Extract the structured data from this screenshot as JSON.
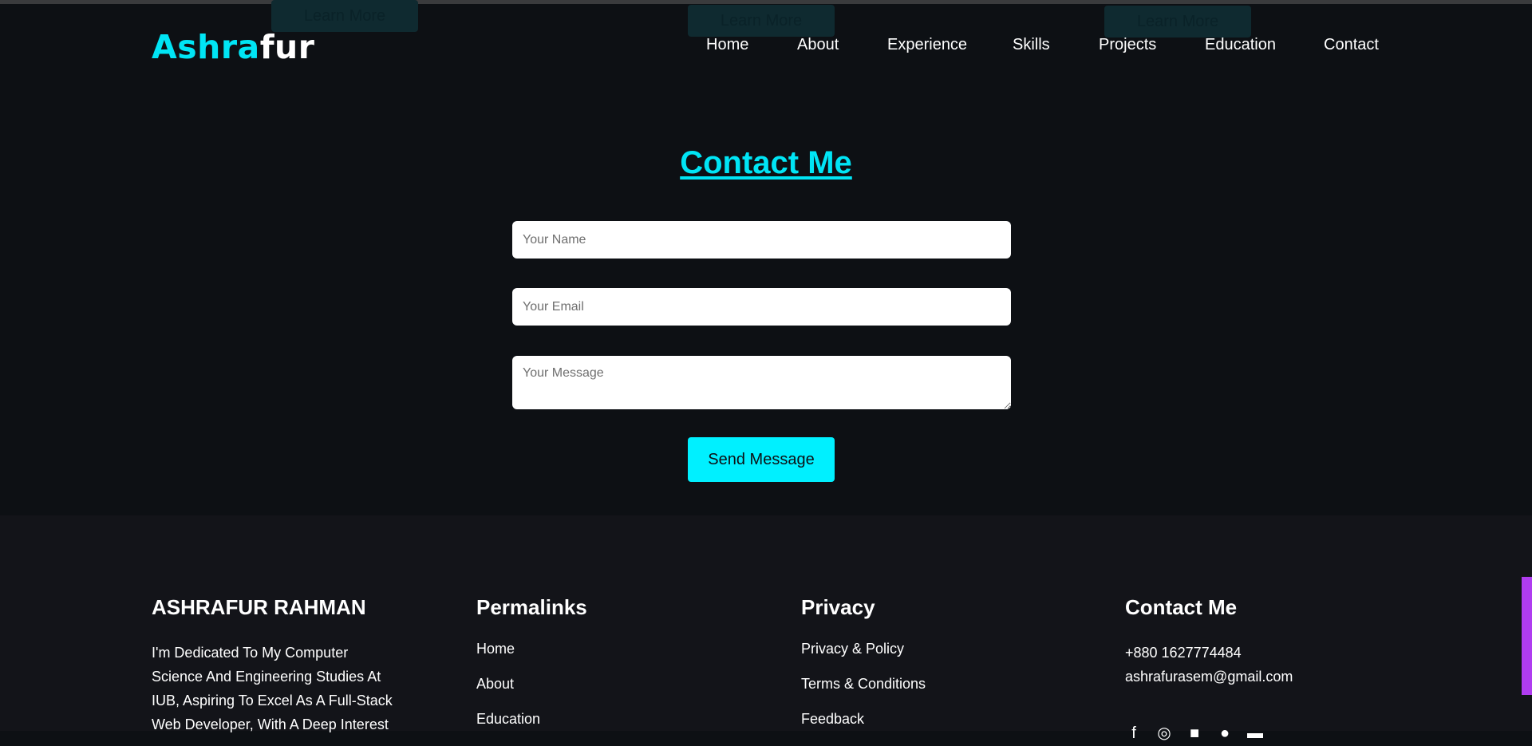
{
  "ghost_buttons": [
    "Learn More",
    "Learn More",
    "Learn More"
  ],
  "logo": {
    "part1": "Ashra",
    "part2": "fur"
  },
  "nav": [
    "Home",
    "About",
    "Experience",
    "Skills",
    "Projects",
    "Education",
    "Contact"
  ],
  "contact": {
    "title": "Contact Me",
    "name_placeholder": "Your Name",
    "email_placeholder": "Your Email",
    "message_placeholder": "Your Message",
    "send_label": "Send Message"
  },
  "footer": {
    "about": {
      "title": "ASHRAFUR RAHMAN",
      "text": "I'm Dedicated To My Computer Science And Engineering Studies At IUB, Aspiring To Excel As A Full-Stack Web Developer, With A Deep Interest"
    },
    "permalinks": {
      "title": "Permalinks",
      "links": [
        "Home",
        "About",
        "Education"
      ]
    },
    "privacy": {
      "title": "Privacy",
      "links": [
        "Privacy & Policy",
        "Terms & Conditions",
        "Feedback"
      ]
    },
    "contact": {
      "title": "Contact Me",
      "phone": "+880 1627774484",
      "email": "ashrafurasem@gmail.com"
    },
    "socials": [
      "facebook-icon",
      "instagram-icon",
      "linkedin-icon",
      "github-icon",
      "youtube-icon"
    ]
  },
  "colors": {
    "accent": "#00e5f5",
    "button": "#00f0ff",
    "background": "#0d1014",
    "footer": "#131419",
    "scroll_accent": "#b03cf0"
  }
}
